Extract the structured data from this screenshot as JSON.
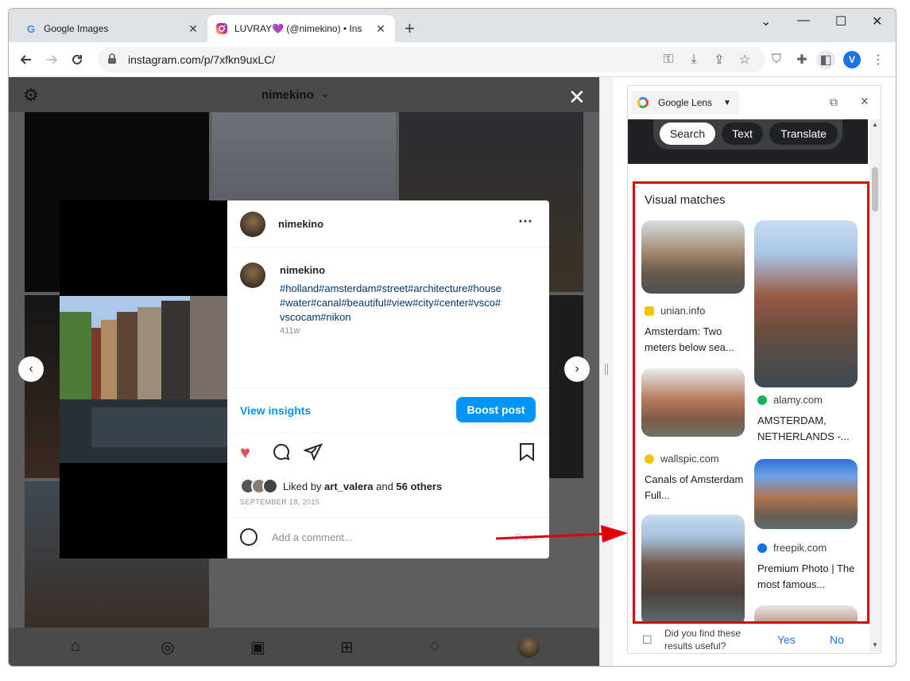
{
  "browser": {
    "tabs": [
      {
        "title": "Google Images",
        "favicon": "G"
      },
      {
        "title": "LUVRAY💜 (@nimekino) • Ins",
        "favicon": "instagram-icon"
      }
    ],
    "url": "instagram.com/p/7xfkn9uxLC/",
    "profile_initial": "V"
  },
  "instagram": {
    "header_username": "nimekino",
    "post": {
      "username": "nimekino",
      "caption_user": "nimekino",
      "caption": "#holland#amsterdam#street#architecture#house #water#canal#beautiful#view#city#center#vsco# vscocam#nikon",
      "age": "411w",
      "view_insights": "View insights",
      "boost_post": "Boost post",
      "liked_by_prefix": "Liked by ",
      "liked_by_user": "art_valera",
      "liked_by_mid": " and ",
      "liked_by_others": "56 others",
      "date": "SEPTEMBER 18, 2015",
      "comment_placeholder": "Add a comment...",
      "post_label": "Post"
    }
  },
  "lens": {
    "title": "Google Lens",
    "tabs": [
      "Search",
      "Text",
      "Translate"
    ],
    "selected_tab": "Search",
    "section_title": "Visual matches",
    "results": [
      {
        "source": "unian.info",
        "title": "Amsterdam: Two meters below sea..."
      },
      {
        "source": "alamy.com",
        "title": "AMSTERDAM, NETHERLANDS -..."
      },
      {
        "source": "wallspic.com",
        "title": "Canals of Amsterdam Full..."
      },
      {
        "source": "freepik.com",
        "title": "Premium Photo | The most famous..."
      }
    ],
    "feedback": {
      "question": "Did you find these results useful?",
      "yes": "Yes",
      "no": "No"
    }
  },
  "colors": {
    "highlight_red": "#e0000b",
    "instagram_blue": "#0095f6",
    "link_blue": "#1a73e8"
  }
}
